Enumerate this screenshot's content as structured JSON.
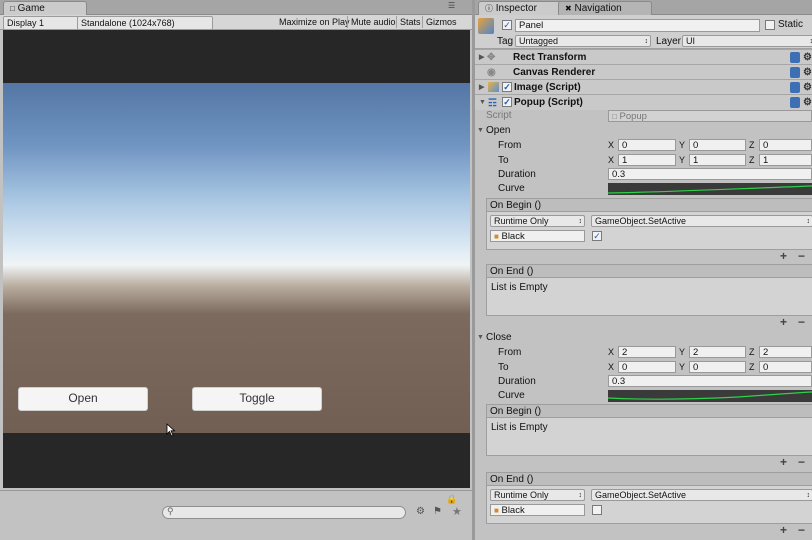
{
  "game": {
    "tab_label": "Game",
    "display": "Display 1",
    "resolution": "Standalone (1024x768)",
    "maximize": "Maximize on Play",
    "mute": "Mute audio",
    "stats": "Stats",
    "gizmos": "Gizmos",
    "open_button": "Open",
    "toggle_button": "Toggle"
  },
  "inspector": {
    "tab_inspector": "Inspector",
    "tab_navigation": "Navigation",
    "object_name": "Panel",
    "static_label": "Static",
    "tag_label": "Tag",
    "tag_value": "Untagged",
    "layer_label": "Layer",
    "layer_value": "UI",
    "components": {
      "rect_transform": "Rect Transform",
      "canvas_renderer": "Canvas Renderer",
      "image": "Image (Script)",
      "popup": "Popup (Script)"
    },
    "script_label": "Script",
    "script_value": "Popup",
    "open": {
      "label": "Open",
      "from_label": "From",
      "from": {
        "x": "0",
        "y": "0",
        "z": "0"
      },
      "to_label": "To",
      "to": {
        "x": "1",
        "y": "1",
        "z": "1"
      },
      "duration_label": "Duration",
      "duration": "0.3",
      "curve_label": "Curve",
      "on_begin": {
        "label": "On Begin ()",
        "runtime": "Runtime Only",
        "function": "GameObject.SetActive",
        "target": "Black",
        "checked": "✓"
      },
      "on_end": {
        "label": "On End ()",
        "empty": "List is Empty"
      }
    },
    "close": {
      "label": "Close",
      "from_label": "From",
      "from": {
        "x": "2",
        "y": "2",
        "z": "2"
      },
      "to_label": "To",
      "to": {
        "x": "0",
        "y": "0",
        "z": "0"
      },
      "duration_label": "Duration",
      "duration": "0.3",
      "curve_label": "Curve",
      "on_begin": {
        "label": "On Begin ()",
        "empty": "List is Empty"
      },
      "on_end": {
        "label": "On End ()",
        "runtime": "Runtime Only",
        "function": "GameObject.SetActive",
        "target": "Black"
      }
    },
    "axis": {
      "x": "X",
      "y": "Y",
      "z": "Z"
    },
    "plus": "+",
    "minus": "−"
  },
  "colors": {
    "curve_line": "#2fd04a",
    "checkbox_tick": "#1e5ebd"
  }
}
